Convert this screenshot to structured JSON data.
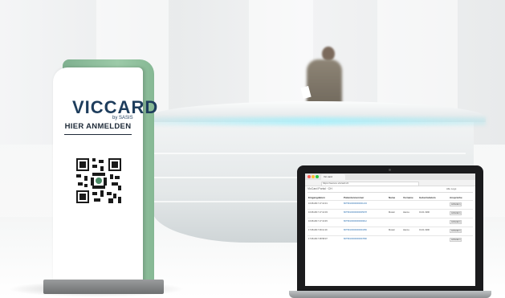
{
  "kiosk": {
    "logo_text": "VICCARD",
    "logo_sub": "by SASIS",
    "title": "HIER ANMELDEN"
  },
  "laptop": {
    "browser_tab": "Vic card",
    "address": "https://secure.viccard.ch",
    "app_header": "VicCard Portal · CH",
    "app_sub": "Alle Logs",
    "columns": [
      "Eingangdatum",
      "Patientennummer",
      "Name",
      "Vorname",
      "Geburtsdatum",
      "Ansprüche"
    ],
    "rows": [
      [
        "16.08.2017 17:14:31",
        "80756100000000001234",
        "",
        "",
        "",
        "Anfordern"
      ],
      [
        "16.08.2017 17:14:03",
        "80756100000000005678",
        "Muster",
        "Hanna",
        "01.01.1990",
        "Anfordern"
      ],
      [
        "16.08.2017 17:13:45",
        "80756100000000009012",
        "",
        "",
        "",
        "Anfordern"
      ],
      [
        "17.08.2017 09:11:19",
        "80756100000000003456",
        "Muster",
        "Hanna",
        "01.01.1990",
        "Anfordern"
      ],
      [
        "17.08.2017 08:58:07",
        "80756100000000007890",
        "",
        "",
        "",
        "Anfordern"
      ]
    ]
  },
  "colors": {
    "kiosk_green": "#9ccaa8",
    "logo_navy": "#1e3d5c",
    "desk_glow": "#aaf0fa"
  }
}
